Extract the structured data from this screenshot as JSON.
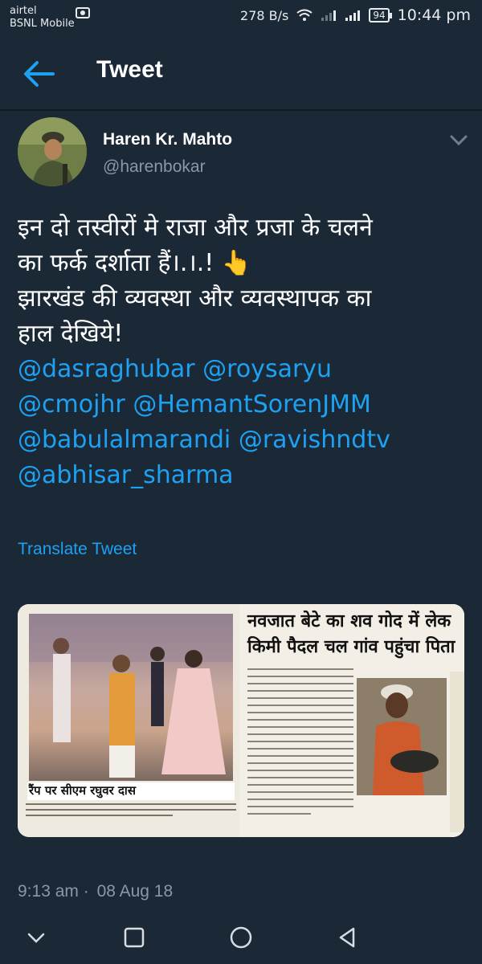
{
  "status_bar": {
    "carrier_1": "airtel",
    "carrier_2": "BSNL Mobile",
    "net_speed": "278 B/s",
    "battery": "94",
    "time": "10:44 pm"
  },
  "header": {
    "title": "Tweet"
  },
  "author": {
    "name": "Haren Kr. Mahto",
    "handle": "@harenbokar"
  },
  "tweet": {
    "line_1": "इन दो तस्वीरों मे राजा और प्रजा के चलने",
    "line_2": "का फर्क दर्शाता हैं।.।.!",
    "line_2_emoji": "👆",
    "line_3": "झारखंड की व्यवस्था और व्यवस्थापक का",
    "line_4": "हाल देखिये!",
    "mentions": {
      "m1": "@dasraghubar",
      "m2": "@roysaryu",
      "m3": "@cmojhr",
      "m4": "@HemantSorenJMM",
      "m5": "@babulalmarandi",
      "m6": "@ravishndtv",
      "m7": "@abhisar_sharma"
    },
    "translate": "Translate Tweet"
  },
  "media": {
    "left_caption": "रैंप पर सीएम रघुवर दास",
    "right_headline_1": "नवजात बेटे का शव गोद में लेक",
    "right_headline_2": "किमी पैदल चल गांव पहुंचा पिता"
  },
  "timestamp": {
    "time": "9:13 am",
    "separator": "·",
    "date": "08 Aug 18"
  },
  "colors": {
    "background": "#1b2836",
    "link": "#1da1f2",
    "muted": "#8899a6"
  }
}
